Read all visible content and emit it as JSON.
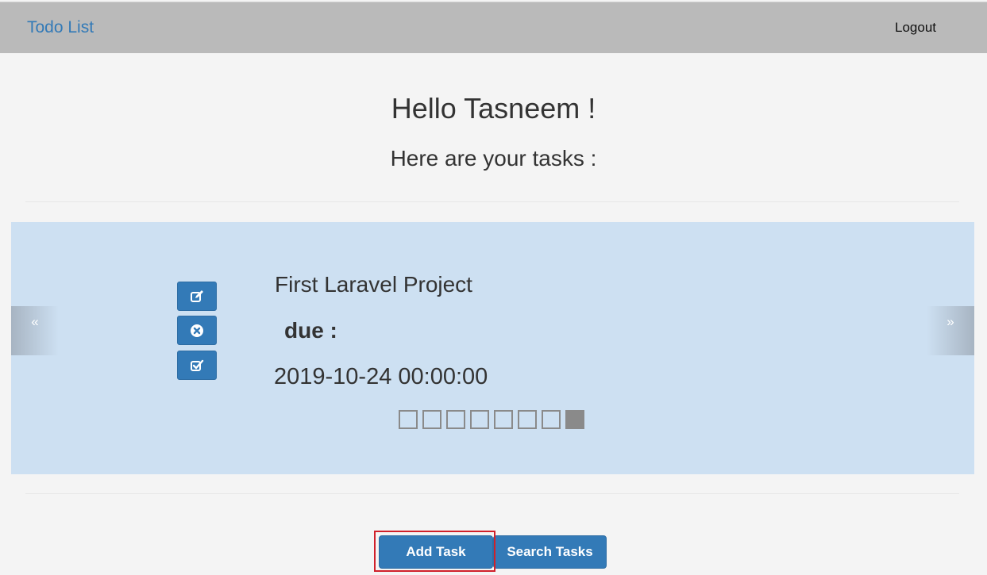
{
  "navbar": {
    "brand": "Todo List",
    "logout_label": "Logout"
  },
  "header": {
    "greeting": "Hello Tasneem !",
    "subheading": "Here are your tasks :"
  },
  "carousel": {
    "prev_glyph": "«",
    "next_glyph": "»",
    "actions": [
      {
        "icon": "edit-icon"
      },
      {
        "icon": "delete-icon"
      },
      {
        "icon": "complete-icon"
      }
    ],
    "task": {
      "title": "First Laravel Project",
      "due_label": "due :",
      "due_date": "2019-10-24 00:00:00"
    },
    "indicators": {
      "count": 8,
      "active_index": 7
    }
  },
  "buttons": {
    "add_task": "Add Task",
    "search_tasks": "Search Tasks"
  },
  "colors": {
    "primary": "#337ab7",
    "navbar": "#bababa",
    "carousel_bg": "#cde0f2",
    "highlight": "#d0202a"
  }
}
